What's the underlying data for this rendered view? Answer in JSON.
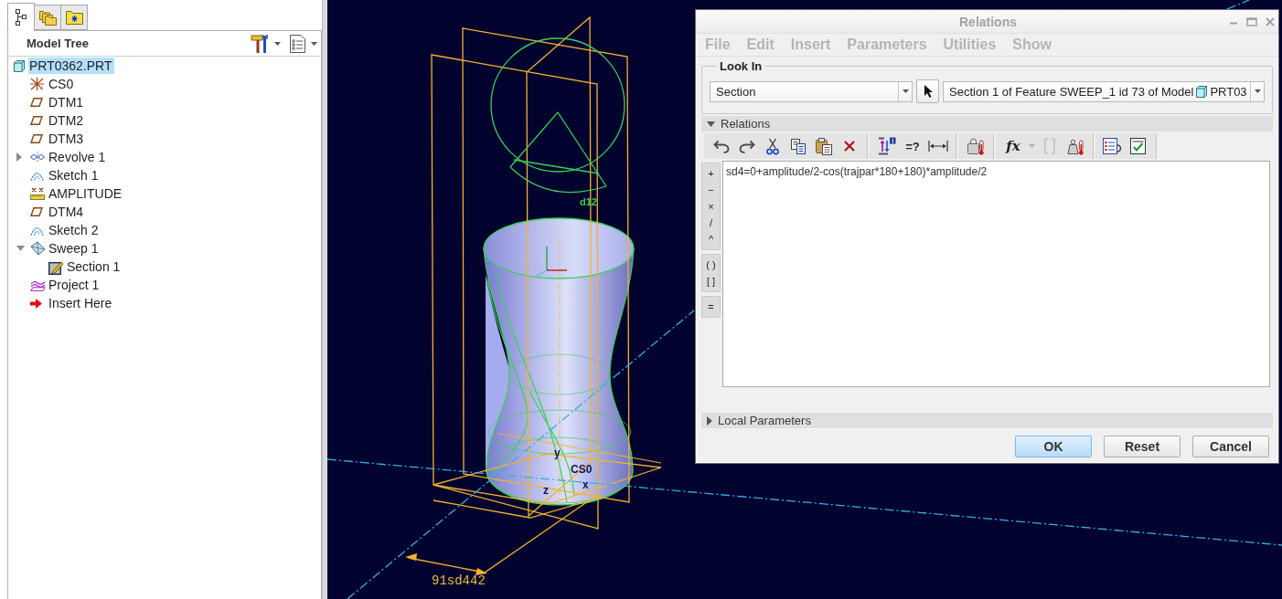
{
  "model_tree": {
    "tabs": [
      {
        "kind": "tree",
        "selected": true
      },
      {
        "kind": "layers",
        "selected": false
      },
      {
        "kind": "favorites",
        "selected": false
      }
    ],
    "title": "Model Tree",
    "items": [
      {
        "label": "PRT0362.PRT",
        "kind": "part",
        "selected": true,
        "children": [
          {
            "label": "CS0",
            "kind": "csys",
            "selected": false
          },
          {
            "label": "DTM1",
            "kind": "datum-plane",
            "selected": false
          },
          {
            "label": "DTM2",
            "kind": "datum-plane",
            "selected": false
          },
          {
            "label": "DTM3",
            "kind": "datum-plane",
            "selected": false
          },
          {
            "label": "Revolve 1",
            "kind": "revolve",
            "selected": false,
            "expanded": false
          },
          {
            "label": "Sketch 1",
            "kind": "sketch",
            "selected": false
          },
          {
            "label": "AMPLITUDE",
            "kind": "analysis",
            "selected": false
          },
          {
            "label": "DTM4",
            "kind": "datum-plane",
            "selected": false
          },
          {
            "label": "Sketch 2",
            "kind": "sketch",
            "selected": false
          },
          {
            "label": "Sweep 1",
            "kind": "sweep",
            "selected": false,
            "expanded": true,
            "children": [
              {
                "label": "Section 1",
                "kind": "section",
                "selected": false
              }
            ]
          },
          {
            "label": "Project 1",
            "kind": "projection",
            "selected": false
          },
          {
            "label": "Insert Here",
            "kind": "insert",
            "selected": false
          }
        ]
      }
    ]
  },
  "viewport": {
    "dimension_labels": [
      "d12",
      "91sd442"
    ],
    "csys_labels": [
      "CS0",
      "x",
      "y",
      "z"
    ]
  },
  "relations_dialog": {
    "title": "Relations",
    "menu": [
      {
        "label": "File",
        "disabled": true
      },
      {
        "label": "Edit",
        "disabled": true
      },
      {
        "label": "Insert",
        "disabled": true
      },
      {
        "label": "Parameters",
        "disabled": true
      },
      {
        "label": "Utilities",
        "disabled": true
      },
      {
        "label": "Show",
        "disabled": true
      }
    ],
    "look_in": {
      "label": "Look In",
      "type": "Section",
      "target": "Section 1 of Feature SWEEP_1 id 73 of Model",
      "target_model": "PRT03"
    },
    "relations": {
      "label": "Relations",
      "expanded": true,
      "toolbar": [
        [
          {
            "kind": "undo",
            "disabled": false
          },
          {
            "kind": "redo",
            "disabled": false
          },
          {
            "kind": "cut",
            "disabled": false
          },
          {
            "kind": "copy",
            "disabled": false
          },
          {
            "kind": "paste",
            "disabled": false
          },
          {
            "kind": "delete",
            "disabled": false
          }
        ],
        [
          {
            "kind": "values",
            "disabled": false
          },
          {
            "kind": "text",
            "label": "=?",
            "disabled": false
          },
          {
            "kind": "dimension",
            "disabled": false
          }
        ],
        [
          {
            "kind": "evaluate",
            "disabled": false
          }
        ],
        [
          {
            "kind": "function",
            "label": "fx",
            "disabled": false
          },
          {
            "kind": "caret",
            "disabled": true
          },
          {
            "kind": "brackets",
            "disabled": true
          },
          {
            "kind": "sensitivity",
            "disabled": false
          }
        ],
        [
          {
            "kind": "sort",
            "disabled": false
          },
          {
            "kind": "verify",
            "disabled": false
          }
        ]
      ],
      "operators": [
        [
          "+",
          "−",
          "×",
          "/",
          "^"
        ],
        [
          "( )",
          "[ ]"
        ],
        [
          "="
        ]
      ],
      "text": "sd4=0+amplitude/2-cos(trajpar*180+180)*amplitude/2"
    },
    "local_parameters": {
      "label": "Local Parameters",
      "expanded": false
    },
    "buttons": [
      {
        "label": "OK",
        "default": true
      },
      {
        "label": "Reset",
        "default": false
      },
      {
        "label": "Cancel",
        "default": false
      }
    ]
  }
}
